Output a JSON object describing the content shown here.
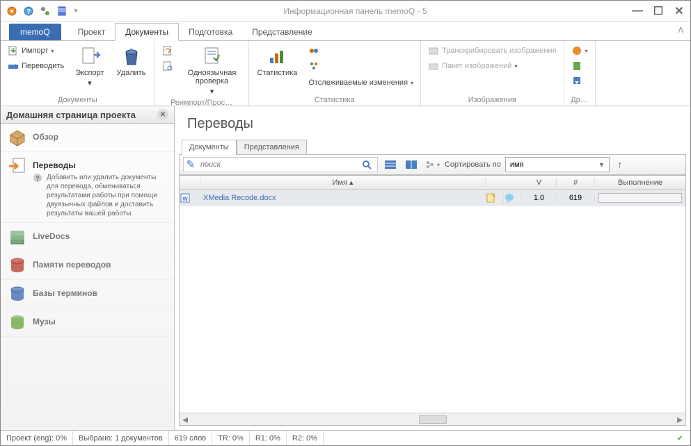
{
  "window": {
    "title": "Информационная панель memoQ - 5"
  },
  "tabs": {
    "app": "memoQ",
    "items": [
      "Проект",
      "Документы",
      "Подготовка",
      "Представление"
    ],
    "active_index": 1
  },
  "ribbon": {
    "groups": [
      {
        "label": "Документы",
        "import": "Импорт",
        "translate": "Переводить",
        "export": "Экспорт",
        "delete": "Удалить"
      },
      {
        "label": "Реимпорт/Прос…",
        "monolingual": "Одноязычная проверка"
      },
      {
        "label": "Статистика",
        "stats": "Статистика",
        "tracked": "Отслеживаемые изменения"
      },
      {
        "label": "Изображения",
        "transcribe": "Транскрибировать изображения",
        "package": "Пакет изображений"
      },
      {
        "label": "Др…"
      }
    ]
  },
  "sidebar": {
    "title": "Домашняя страница проекта",
    "items": [
      {
        "label": "Обзор"
      },
      {
        "label": "Переводы",
        "desc": "Добавить или удалить документы для перевода, обмениваться результатами работы при помощи двуязычных файлов и доставить результаты вашей работы"
      },
      {
        "label": "LiveDocs"
      },
      {
        "label": "Памяти переводов"
      },
      {
        "label": "Базы терминов"
      },
      {
        "label": "Музы"
      }
    ],
    "active_index": 1
  },
  "main": {
    "title": "Переводы",
    "subtabs": [
      "Документы",
      "Представления"
    ],
    "subtab_active": 0,
    "search_placeholder": "поиск",
    "sort_label": "Сортировать по",
    "sort_value": "имя",
    "columns": {
      "name": "Имя",
      "v": "V",
      "hash": "#",
      "progress": "Выполнение"
    },
    "rows": [
      {
        "name": "XMedia Recode.docx",
        "v": "1.0",
        "hash": "619"
      }
    ]
  },
  "status": {
    "project": "Проект (eng): 0%",
    "selected": "Выбрано:  1 документов",
    "words": "619 слов",
    "tr": "TR: 0%",
    "r1": "R1: 0%",
    "r2": "R2: 0%"
  }
}
